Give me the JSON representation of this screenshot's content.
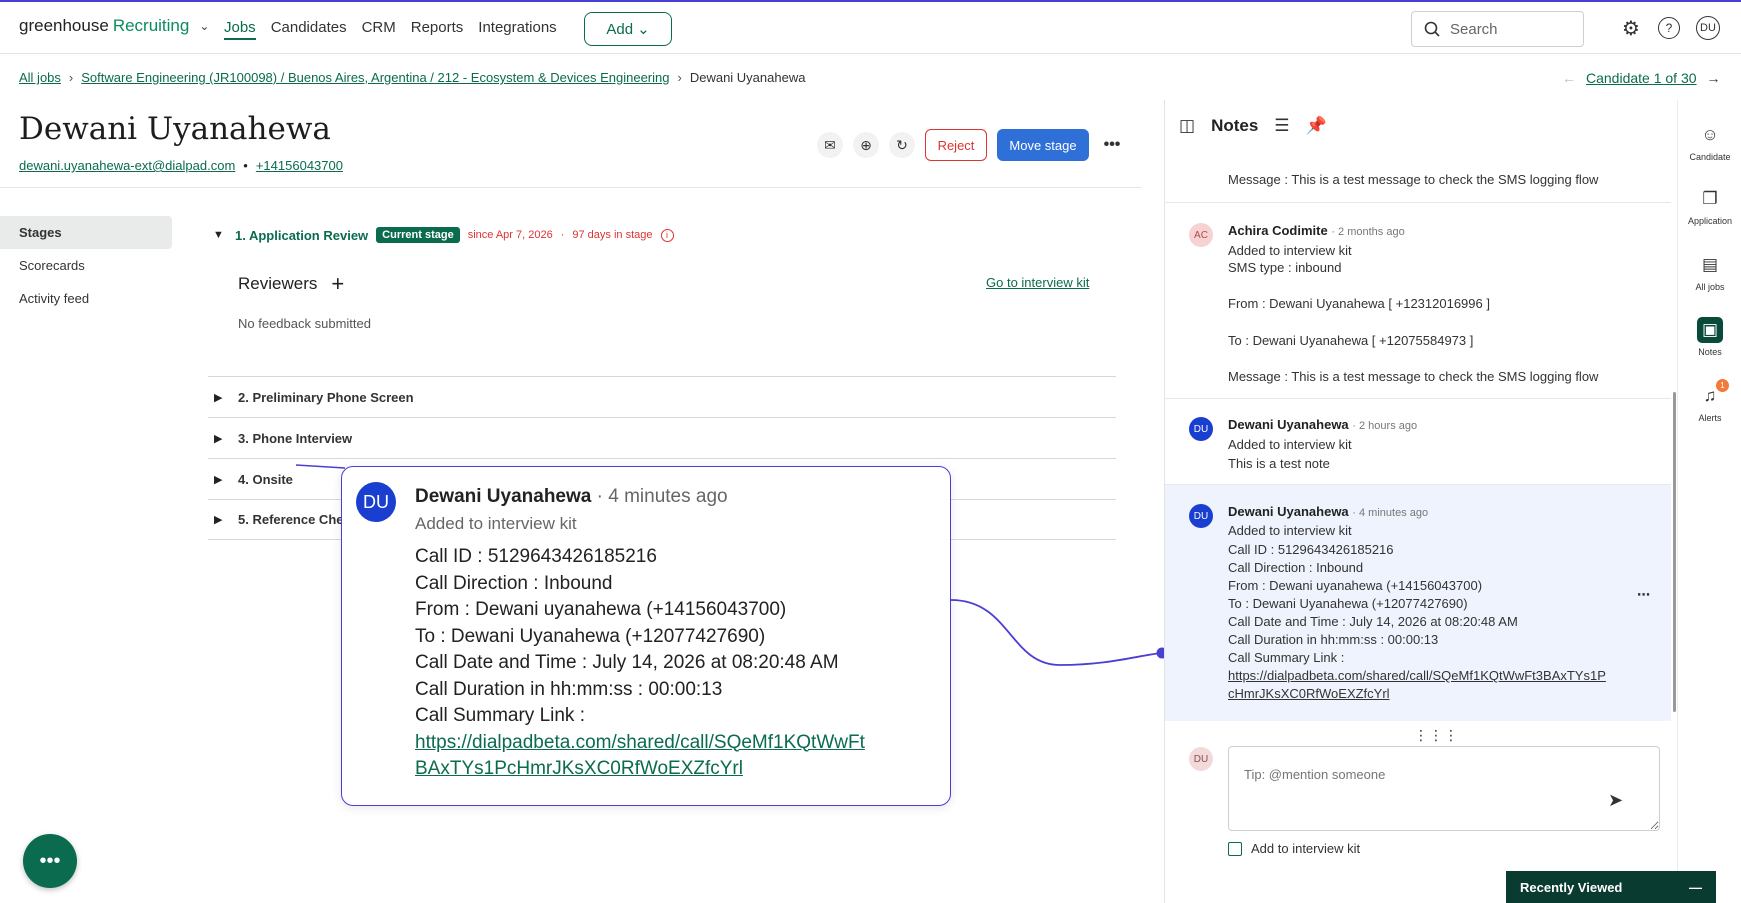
{
  "app": {
    "logo_main": "greenhouse",
    "logo_sub": "Recruiting",
    "nav": [
      "Jobs",
      "Candidates",
      "CRM",
      "Reports",
      "Integrations"
    ],
    "add_label": "Add",
    "search_placeholder": "Search",
    "user_initials": "DU"
  },
  "breadcrumb": {
    "all_jobs": "All jobs",
    "job": "Software Engineering (JR100098) / Buenos Aires, Argentina / 212 - Ecosystem & Devices Engineering",
    "current": "Dewani Uyanahewa",
    "candidate_nav": "Candidate 1 of 30"
  },
  "candidate": {
    "name": "Dewani Uyanahewa",
    "email": "dewani.uyanahewa-ext@dialpad.com",
    "phone": "+14156043700",
    "reject_label": "Reject",
    "move_label": "Move stage"
  },
  "leftnav": [
    "Stages",
    "Scorecards",
    "Activity feed"
  ],
  "stages": {
    "current": {
      "name": "1. Application Review",
      "badge": "Current stage",
      "since": "since Apr 7, 2026",
      "days": "97 days in stage"
    },
    "reviewers_label": "Reviewers",
    "go_to_kit": "Go to interview kit",
    "no_feedback": "No feedback submitted",
    "others": [
      "2. Preliminary Phone Screen",
      "3. Phone Interview",
      "4. Onsite",
      "5. Reference Che"
    ]
  },
  "popover": {
    "initials": "DU",
    "author": "Dewani Uyanahewa",
    "time": "· 4 minutes ago",
    "subtitle": "Added to interview kit",
    "lines": [
      "Call ID : 5129643426185216",
      "Call Direction : Inbound",
      "From : Dewani uyanahewa (+14156043700)",
      "To : Dewani Uyanahewa (+12077427690)",
      "Call Date and Time : July 14, 2026 at 08:20:48 AM",
      "Call Duration in hh:mm:ss : 00:00:13",
      "Call Summary Link :"
    ],
    "link_line1": "https://dialpadbeta.com/shared/call/SQeMf1KQtWwFt",
    "link_line2": "BAxTYs1PcHmrJKsXC0RfWoEXZfcYrl"
  },
  "notes": {
    "title": "Notes",
    "items": [
      {
        "message": "Message : This is a test message to check the SMS logging flow"
      },
      {
        "initials": "AC",
        "author": "Achira Codimite",
        "time": "· 2 months ago",
        "subtitle": "Added to interview kit",
        "lines": [
          "SMS type : inbound",
          "From : Dewani Uyanahewa [ +12312016996 ]",
          "To : Dewani Uyanahewa [ +12075584973 ]",
          "Message : This is a test message to check the SMS logging flow"
        ]
      },
      {
        "initials": "DU",
        "author": "Dewani Uyanahewa",
        "time": "· 2 hours ago",
        "subtitle": "Added to interview kit",
        "lines": [
          "This is a test note"
        ]
      },
      {
        "initials": "DU",
        "author": "Dewani Uyanahewa",
        "time": "· 4 minutes ago",
        "subtitle": "Added to interview kit",
        "lines": [
          "Call ID : 5129643426185216",
          "Call Direction : Inbound",
          "From : Dewani uyanahewa (+14156043700)",
          "To : Dewani Uyanahewa (+12077427690)",
          "Call Date and Time : July 14, 2026 at 08:20:48 AM",
          "Call Duration in hh:mm:ss : 00:00:13",
          "Call Summary Link :"
        ],
        "link_line1": "https://dialpadbeta.com/shared/call/SQeMf1KQtWwFt3BAxTYs1P",
        "link_line2": "cHmrJKsXC0RfWoEXZfcYrl"
      }
    ],
    "compose_initials": "DU",
    "compose_placeholder": "Tip: @mention someone",
    "add_to_kit": "Add to interview kit"
  },
  "rail": {
    "items": [
      "Candidate",
      "Application",
      "All jobs",
      "Notes",
      "Alerts"
    ],
    "alerts_count": "1"
  },
  "recently_viewed": "Recently Viewed",
  "colors": {
    "brand_green": "#0a6b4f",
    "accent_blue": "#2e6fd8",
    "reject_red": "#dd3333",
    "highlight": "#4a3fd3"
  }
}
